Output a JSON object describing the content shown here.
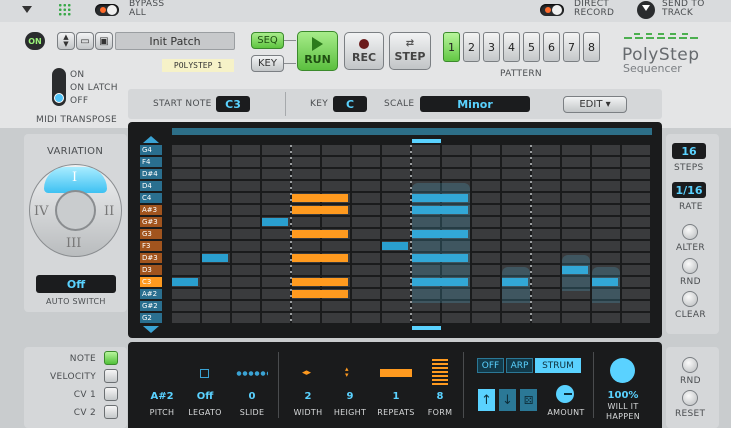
{
  "top": {
    "bypass_label": "BYPASS\nALL",
    "direct_record_label": "DIRECT\nRECORD",
    "send_to_track_label": "SEND TO\nTRACK"
  },
  "device": {
    "power_label": "ON",
    "patch_name": "Init Patch",
    "brand_label": "POLYSTEP 1",
    "title": "PolyStep",
    "subtitle": "Sequencer"
  },
  "transport": {
    "seq_label": "SEQ",
    "key_label": "KEY",
    "run_label": "RUN",
    "rec_label": "REC",
    "step_label": "STEP"
  },
  "pattern": {
    "label": "PATTERN",
    "buttons": [
      "1",
      "2",
      "3",
      "4",
      "5",
      "6",
      "7",
      "8"
    ],
    "selected": "1"
  },
  "midi_transpose": {
    "options": [
      "ON",
      "ON LATCH",
      "OFF"
    ],
    "label": "MIDI TRANSPOSE"
  },
  "settings": {
    "start_note_label": "START NOTE",
    "start_note_value": "C3",
    "key_label": "KEY",
    "key_value": "C",
    "scale_label": "SCALE",
    "scale_value": "Minor",
    "edit_label": "EDIT ▾"
  },
  "variation": {
    "label": "VARIATION",
    "quadrants": [
      "I",
      "II",
      "III",
      "IV"
    ],
    "auto_switch_value": "Off",
    "auto_switch_label": "AUTO SWITCH"
  },
  "keys": [
    "G4",
    "F4",
    "D#4",
    "D4",
    "C4",
    "A#3",
    "G#3",
    "G3",
    "F3",
    "D#3",
    "D3",
    "C3",
    "A#2",
    "G#2",
    "G2"
  ],
  "right_panel": {
    "steps_value": "16",
    "steps_label": "STEPS",
    "rate_value": "1/16",
    "rate_label": "RATE",
    "alter_label": "ALTER",
    "rnd_label": "RND",
    "clear_label": "CLEAR",
    "rnd2_label": "RND",
    "reset_label": "RESET"
  },
  "lanes": {
    "items": [
      {
        "label": "NOTE",
        "active": true
      },
      {
        "label": "VELOCITY",
        "active": false
      },
      {
        "label": "CV 1",
        "active": false
      },
      {
        "label": "CV 2",
        "active": false
      }
    ]
  },
  "step_params": {
    "pitch": {
      "value": "A#2",
      "label": "PITCH"
    },
    "legato": {
      "value": "Off",
      "label": "LEGATO"
    },
    "slide": {
      "value": "0",
      "label": "SLIDE"
    },
    "width": {
      "value": "2",
      "label": "WIDTH"
    },
    "height": {
      "value": "9",
      "label": "HEIGHT"
    },
    "repeats": {
      "value": "1",
      "label": "REPEATS"
    },
    "form": {
      "value": "8",
      "label": "FORM"
    },
    "modes": [
      "OFF",
      "ARP",
      "STRUM"
    ],
    "selected_mode": "STRUM",
    "amount_label": "AMOUNT",
    "chance_value": "100%",
    "chance_label": "WILL IT\nHAPPEN"
  },
  "colors": {
    "accent": "#5ad2ff",
    "orange": "#ff9a1f",
    "green": "#62c744",
    "grid_bg": "#1a1b1c"
  }
}
